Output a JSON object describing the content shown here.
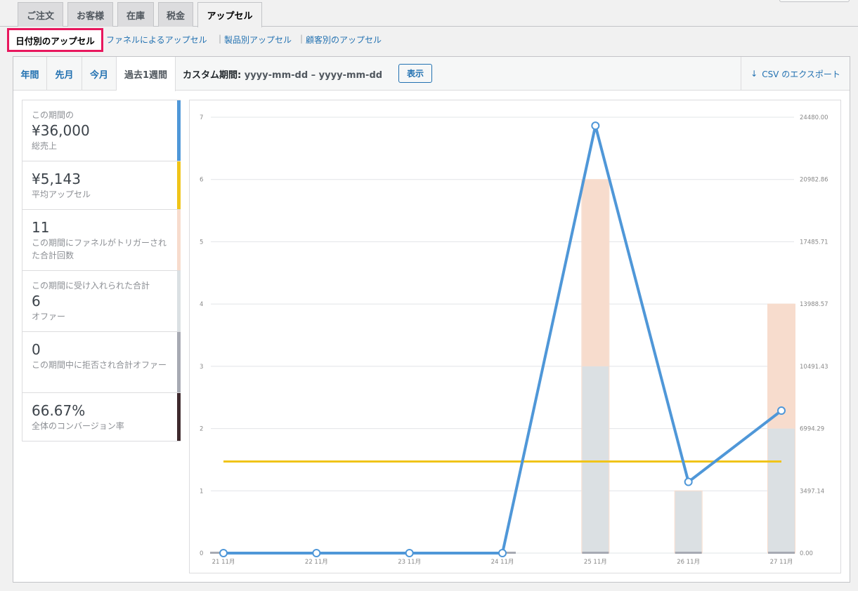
{
  "top_tabs": [
    {
      "label": "ご注文"
    },
    {
      "label": "お客様"
    },
    {
      "label": "在庫"
    },
    {
      "label": "税金"
    },
    {
      "label": "アップセル"
    }
  ],
  "subnav": {
    "current": "日付別のアップセル",
    "links": [
      "ファネルによるアップセル",
      "製品別アップセル",
      "顧客別のアップセル"
    ],
    "separator": "|"
  },
  "range_tabs": [
    "年間",
    "先月",
    "今月",
    "過去1週間"
  ],
  "custom_range": {
    "label": "カスタム期間:",
    "dates": "yyyy-mm-dd – yyyy-mm-dd",
    "button": "表示"
  },
  "export": {
    "icon": "arrow-down-icon",
    "label": "CSV のエクスポート"
  },
  "legend": [
    {
      "pre": "この期間の",
      "value": "¥36,000",
      "post": "総売上",
      "color": "#4f97d8"
    },
    {
      "pre": "",
      "value": "¥5,143",
      "post": "平均アップセル",
      "color": "#f0c419"
    },
    {
      "pre": "",
      "value": "11",
      "post": "この期間にファネルがトリガーされた合計回数",
      "color": "#f7dccd"
    },
    {
      "pre": "この期間に受け入れられた合計",
      "value": "6",
      "post": "オファー",
      "color": "#dbe0e3"
    },
    {
      "pre": "",
      "value": "0",
      "post": "この期間中に拒否され合計オファー",
      "color": "#a7aab3"
    },
    {
      "pre": "",
      "value": "66.67%",
      "post": "全体のコンバージョン率",
      "color": "#3f2a2e"
    }
  ],
  "chart_data": {
    "type": "bar",
    "categories": [
      "21 11月",
      "22 11月",
      "23 11月",
      "24 11月",
      "25 11月",
      "26 11月",
      "27 11月"
    ],
    "yticks_left": [
      "0",
      "1",
      "2",
      "3",
      "4",
      "5",
      "6",
      "7"
    ],
    "yticks_right": [
      "0.00",
      "3497.14",
      "6994.29",
      "10491.43",
      "13988.57",
      "17485.71",
      "20982.86",
      "24480.00"
    ],
    "ylim_left": [
      0,
      7
    ],
    "ylim_right": [
      0,
      24480
    ],
    "series": [
      {
        "values": [
          0,
          0,
          0,
          0,
          3,
          1,
          2
        ],
        "color": "#dbe0e3",
        "axis": "left",
        "kind": "stacked-bar"
      },
      {
        "values": [
          0,
          0,
          0,
          0,
          3,
          0,
          2
        ],
        "color": "#f7dccd",
        "axis": "left",
        "kind": "stacked-bar"
      },
      {
        "values": [
          0,
          0,
          0,
          0,
          0,
          0,
          0
        ],
        "color": "#a7aab3",
        "axis": "left",
        "kind": "baseline-bar"
      },
      {
        "values": [
          0,
          0,
          0,
          0,
          24000,
          4000,
          8000
        ],
        "color": "#4f97d8",
        "axis": "right",
        "kind": "line-points"
      },
      {
        "values": [
          5143,
          5143,
          5143,
          5143,
          5143,
          5143,
          5143
        ],
        "color": "#f0c419",
        "axis": "right",
        "kind": "line"
      }
    ],
    "grid": true
  }
}
